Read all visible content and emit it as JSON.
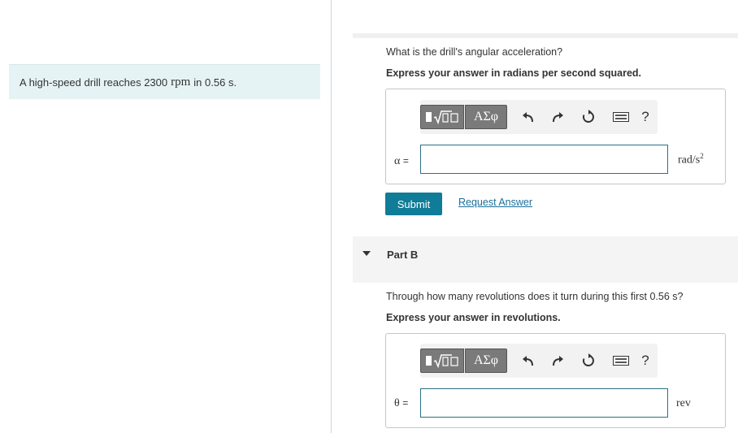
{
  "problem": {
    "text_before": "A high-speed drill reaches 2300",
    "unit": "rpm",
    "text_after": "in 0.56 s."
  },
  "part_a": {
    "question": "What is the drill's angular acceleration?",
    "instruction": "Express your answer in radians per second squared.",
    "variable": "α",
    "equals": "=",
    "input_value": "",
    "unit_main": "rad/s",
    "unit_sup": "2",
    "submit_label": "Submit",
    "request_label": "Request Answer"
  },
  "toolbar": {
    "greek_label": "ΑΣφ",
    "help_label": "?"
  },
  "part_b": {
    "label": "Part B",
    "question": "Through how many revolutions does it turn during this first 0.56 s?",
    "instruction": "Express your answer in revolutions.",
    "variable": "θ",
    "equals": "=",
    "input_value": "",
    "unit": "rev"
  },
  "colors": {
    "accent": "#0f7c98",
    "link": "#1b6f9a",
    "problem_bg": "#e6f3f5"
  }
}
